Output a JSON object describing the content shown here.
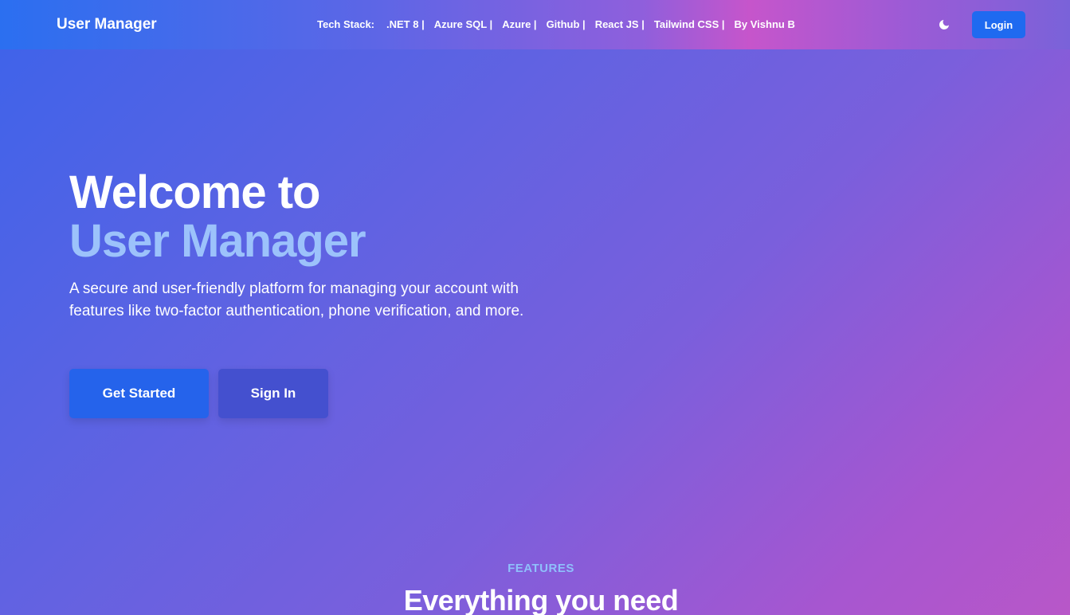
{
  "navbar": {
    "brand": "User Manager",
    "stack_label": "Tech Stack:",
    "stack_items": [
      ".NET 8 |",
      "Azure SQL |",
      "Azure |",
      "Github |",
      "React JS |",
      "Tailwind CSS |",
      "By Vishnu B"
    ],
    "theme_icon": "moon-icon",
    "login_label": "Login"
  },
  "hero": {
    "title_line1": "Welcome to",
    "title_line2": "User Manager",
    "description": "A secure and user-friendly platform for managing your account with features like two-factor authentication, phone verification, and more.",
    "primary_button": "Get Started",
    "secondary_button": "Sign In"
  },
  "features": {
    "eyebrow": "FEATURES",
    "heading": "Everything you need"
  },
  "colors": {
    "accent_blue": "#2563eb",
    "highlight_text": "#9cc2fb",
    "secondary_button": "#4450cf"
  }
}
